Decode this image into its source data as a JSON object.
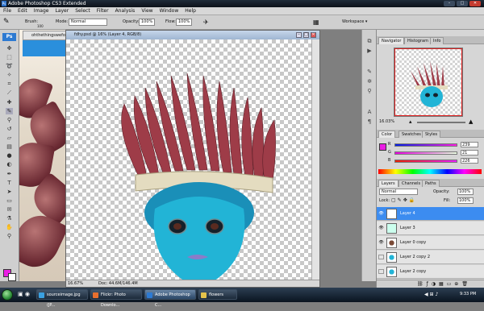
{
  "app": {
    "title": "Adobe Photoshop CS3 Extended",
    "logo": "Ps",
    "window_controls": {
      "minimize": "–",
      "maximize": "□",
      "close": "✕"
    }
  },
  "menubar": {
    "items": [
      "File",
      "Edit",
      "Image",
      "Layer",
      "Select",
      "Filter",
      "Analysis",
      "View",
      "Window",
      "Help"
    ]
  },
  "options_bar": {
    "brush_label": "Brush:",
    "brush_size": "100",
    "mode_label": "Mode:",
    "mode_value": "Normal",
    "opacity_label": "Opacity:",
    "opacity_value": "100%",
    "flow_label": "Flow:",
    "flow_value": "100%",
    "workspace_label": "Workspace ▾"
  },
  "background_doc": {
    "tab_label": "ohthethingsweforge"
  },
  "document": {
    "title": "fdhy.psd @ 16% (Layer 4, RGB/8)",
    "zoom": "16.67%",
    "doc_size": "Doc: 44.6M/146.4M"
  },
  "navigator": {
    "tabs": [
      "Navigator",
      "Histogram",
      "Info"
    ],
    "zoom": "16.03%"
  },
  "color_panel": {
    "tabs": [
      "Color",
      "Swatches",
      "Styles"
    ],
    "channels": [
      {
        "label": "R",
        "value": "239"
      },
      {
        "label": "G",
        "value": "21"
      },
      {
        "label": "B",
        "value": "226"
      }
    ],
    "foreground": "#ea1ee3"
  },
  "layers_panel": {
    "tabs": [
      "Layers",
      "Channels",
      "Paths"
    ],
    "blend_mode": "Normal",
    "opacity_label": "Opacity:",
    "opacity_value": "100%",
    "lock_label": "Lock:",
    "fill_label": "Fill:",
    "fill_value": "100%",
    "layers": [
      {
        "name": "Layer 4",
        "visible": true,
        "selected": true
      },
      {
        "name": "Layer 3",
        "visible": true,
        "selected": false
      },
      {
        "name": "Layer 0 copy",
        "visible": true,
        "selected": false
      },
      {
        "name": "Layer 2 copy 2",
        "visible": false,
        "selected": false
      },
      {
        "name": "Layer 2 copy",
        "visible": false,
        "selected": false
      }
    ]
  },
  "taskbar": {
    "tasks": [
      {
        "label": "sourceimage.jpg (JP...",
        "active": false
      },
      {
        "label": "Flickr: Photo Downlo...",
        "active": false
      },
      {
        "label": "Adobe Photoshop C...",
        "active": true
      },
      {
        "label": "flowers",
        "active": false
      }
    ],
    "clock": "9:33 PM"
  },
  "colors": {
    "accent": "#3c8cf0",
    "magenta": "#ea1ee3",
    "skin": "#1fb6d6",
    "feather": "#a8464f"
  },
  "icons": {
    "tools": [
      "move-tool",
      "marquee-tool",
      "lasso-tool",
      "magic-wand-tool",
      "crop-tool",
      "slice-tool",
      "healing-brush-tool",
      "brush-tool",
      "clone-stamp-tool",
      "history-brush-tool",
      "eraser-tool",
      "gradient-tool",
      "blur-tool",
      "dodge-tool",
      "pen-tool",
      "type-tool",
      "path-selection-tool",
      "shape-tool",
      "notes-tool",
      "eyedropper-tool",
      "hand-tool",
      "zoom-tool"
    ]
  }
}
